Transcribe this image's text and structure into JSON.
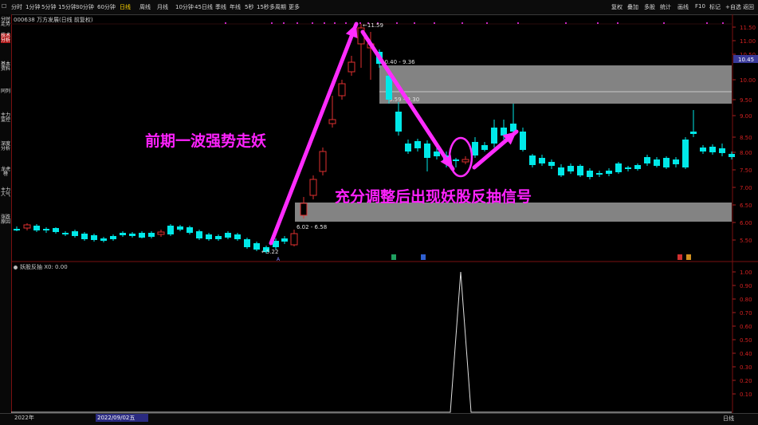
{
  "toolbar": {
    "left_items": [
      "分时",
      "1分钟",
      "5分钟",
      "15分钟",
      "30分钟",
      "60分钟",
      "日线",
      "周线",
      "月线",
      "10分钟",
      "45日线",
      "季线",
      "年线",
      "5秒",
      "15秒",
      "多周期",
      "更多"
    ],
    "active": "日线",
    "right_items": [
      "复权",
      "叠加",
      "多股",
      "统计",
      "画线",
      "F10",
      "标记",
      "+自选",
      "返回"
    ]
  },
  "stock_title": "000638 万方发展(日线 前复权)",
  "sidebar": [
    {
      "label": "分时走势",
      "highlight": false
    },
    {
      "label": "技术分析",
      "highlight": true
    },
    {
      "label": "基本资料",
      "highlight": false
    },
    {
      "label": "同列",
      "highlight": false
    },
    {
      "label": "主力监控",
      "highlight": false
    },
    {
      "label": "深度分析",
      "highlight": false
    },
    {
      "label": "龙虎榜",
      "highlight": false
    },
    {
      "label": "主力人气",
      "highlight": false
    },
    {
      "label": "涨跌原因",
      "highlight": false
    }
  ],
  "price_axis": [
    "11.50",
    "11.00",
    "10.50",
    "10.00",
    "9.50",
    "9.00",
    "8.50",
    "8.00",
    "7.50",
    "7.00",
    "6.50",
    "6.00",
    "5.50"
  ],
  "current_price_tag": "10.45",
  "zone_labels": {
    "upper": "10.40 - 9.36",
    "upper2": "9.59 - 9.30",
    "lower": "6.02 - 6.58"
  },
  "price_markers": {
    "high": "11.59",
    "low": "5.22"
  },
  "annotations": {
    "left": "前期一波强势走妖",
    "right": "充分调整后出现妖股反抽信号"
  },
  "indicator": {
    "title": "妖股反抽  X0: 0.00",
    "axis": [
      "1.00",
      "0.90",
      "0.80",
      "0.70",
      "0.60",
      "0.50",
      "0.40",
      "0.30",
      "0.20",
      "0.10"
    ]
  },
  "bottom": {
    "year": "2022年",
    "date": "2022/09/02五",
    "right": "日线"
  },
  "colors": {
    "up": "#e03030",
    "down": "#00e8e8",
    "annot": "#ff22ff",
    "zone": "#9a9a9a",
    "arrow": "#ff2cff"
  }
}
